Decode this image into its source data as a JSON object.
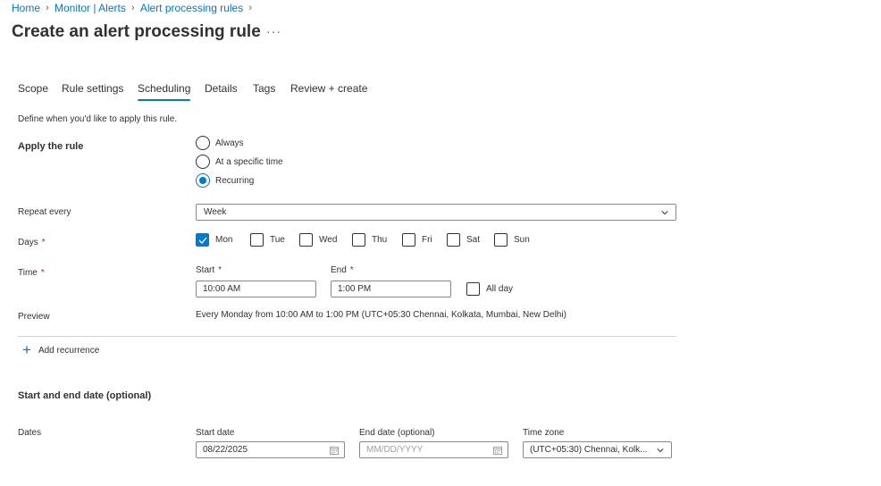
{
  "breadcrumb": [
    "Home",
    "Monitor | Alerts",
    "Alert processing rules"
  ],
  "page_title": "Create an alert processing rule",
  "more_label": "···",
  "tabs": [
    "Scope",
    "Rule settings",
    "Scheduling",
    "Details",
    "Tags",
    "Review + create"
  ],
  "active_tab": "Scheduling",
  "description": "Define when you'd like to apply this rule.",
  "apply_rule": {
    "label": "Apply the rule",
    "options": [
      "Always",
      "At a specific time",
      "Recurring"
    ],
    "selected": "Recurring"
  },
  "repeat": {
    "label": "Repeat every",
    "value": "Week"
  },
  "days": {
    "label": "Days",
    "required_mark": "*",
    "items": [
      {
        "label": "Mon",
        "checked": true
      },
      {
        "label": "Tue",
        "checked": false
      },
      {
        "label": "Wed",
        "checked": false
      },
      {
        "label": "Thu",
        "checked": false
      },
      {
        "label": "Fri",
        "checked": false
      },
      {
        "label": "Sat",
        "checked": false
      },
      {
        "label": "Sun",
        "checked": false
      }
    ]
  },
  "time": {
    "label": "Time",
    "required_mark": "*",
    "start_label": "Start",
    "start_value": "10:00 AM",
    "end_label": "End",
    "end_value": "1:00 PM",
    "all_day_label": "All day",
    "all_day_checked": false
  },
  "preview": {
    "label": "Preview",
    "text": "Every Monday from 10:00 AM to 1:00 PM (UTC+05:30 Chennai, Kolkata, Mumbai, New Delhi)"
  },
  "add_recurrence_label": "Add recurrence",
  "dates_section": {
    "title": "Start and end date (optional)",
    "label": "Dates",
    "start_date_label": "Start date",
    "start_date_value": "08/22/2025",
    "end_date_label": "End date (optional)",
    "end_date_placeholder": "MM/DD/YYYY",
    "timezone_label": "Time zone",
    "timezone_value": "(UTC+05:30) Chennai, Kolk..."
  },
  "colors": {
    "accent": "#0078d4",
    "required": "#a4262c",
    "text": "#323130",
    "border": "#8a8886"
  },
  "icons": [
    "chevron-right-icon",
    "more-icon",
    "chevron-down-icon",
    "checkmark-icon",
    "calendar-icon",
    "plus-icon"
  ]
}
